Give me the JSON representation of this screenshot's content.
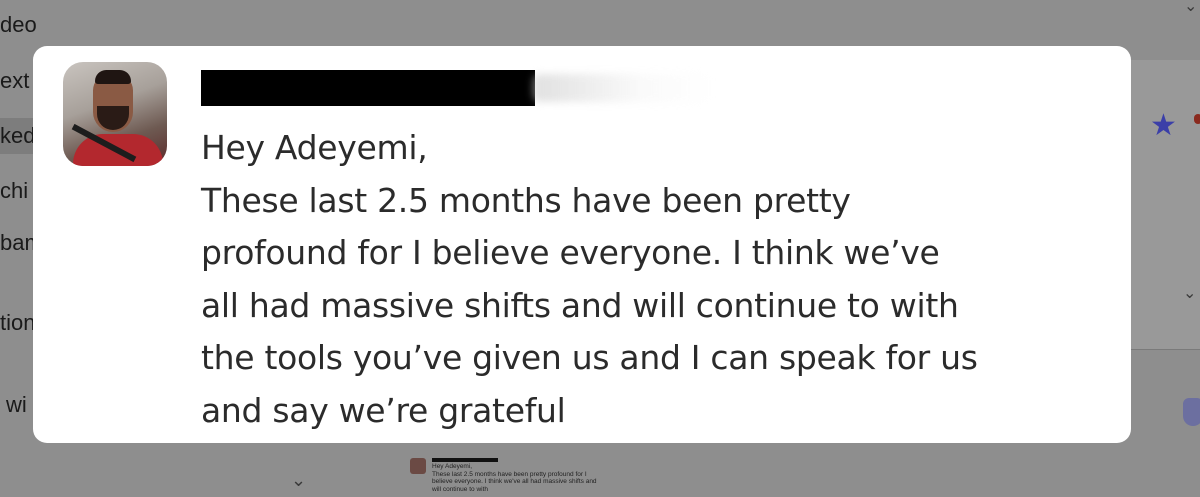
{
  "background": {
    "sidebar_items": [
      "deo",
      "ext",
      "ked",
      "chi",
      "bam",
      "tion",
      "wi"
    ],
    "thumbnail": {
      "greeting": "Hey Adeyemi,",
      "text": "These last 2.5 months have been pretty profound for I believe everyone. I think we've all had massive shifts and will continue to with"
    }
  },
  "card": {
    "message_lines": [
      "Hey Adeyemi,",
      "These last 2.5 months have been pretty",
      "profound for I believe everyone. I think we’ve",
      "all had massive shifts and will continue to with",
      "the tools you’ve given us and I can speak for us",
      "and say we’re grateful"
    ]
  },
  "colors": {
    "overlay": "#8e8e8e",
    "card": "#ffffff",
    "text": "#2b2b2b",
    "star": "#3b3fa8"
  }
}
